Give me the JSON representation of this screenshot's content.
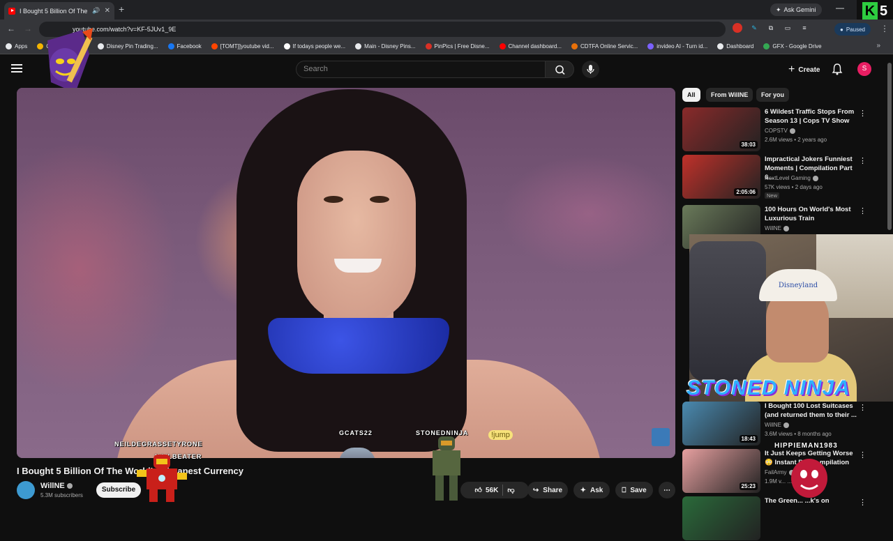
{
  "browser": {
    "tab_title": "I Bought 5 Billion Of The W",
    "new_tab": "+",
    "ask_gemini": "Ask Gemini",
    "url": "youtube.com/watch?v=KF-5JUv1_9E",
    "paused": "Paused",
    "bookmarks": [
      {
        "label": "Apps",
        "color": "#e8eaed"
      },
      {
        "label": "Comp...ive Gol...",
        "color": "#f4b400"
      },
      {
        "label": "Disney Pin Trading...",
        "color": "#e8eaed"
      },
      {
        "label": "Facebook",
        "color": "#1877f2"
      },
      {
        "label": "[TOMT]]youtube vid...",
        "color": "#ff4500"
      },
      {
        "label": "If todays people we...",
        "color": "#ffffff"
      },
      {
        "label": "Main - Disney Pins...",
        "color": "#e8eaed"
      },
      {
        "label": "PinPics | Free Disne...",
        "color": "#d93025"
      },
      {
        "label": "Channel dashboard...",
        "color": "#ff0000"
      },
      {
        "label": "CDTFA Online Servic...",
        "color": "#e8710a"
      },
      {
        "label": "invideo AI - Turn id...",
        "color": "#7b61ff"
      },
      {
        "label": "Dashboard",
        "color": "#e8eaed"
      },
      {
        "label": "GFX - Google Drive",
        "color": "#34a853"
      }
    ]
  },
  "youtube": {
    "search_placeholder": "Search",
    "create": "Create",
    "avatar_letter": "S"
  },
  "video": {
    "title": "I Bought 5 Billion Of The World's Cheapest Currency",
    "channel": "WillNE",
    "subscribers": "5.3M subscribers",
    "subscribe": "Subscribe",
    "likes": "56K",
    "share": "Share",
    "ask": "Ask",
    "save": "Save"
  },
  "stickers": {
    "gcats": "GCATS22",
    "stonedninja": "STONEDNINJA",
    "jump": "!jump",
    "neil": "NEILDEGRASSETYRONE",
    "nail": "NAILBEATER",
    "hippie": "HIPPIEMAN1983",
    "stoned_title": "STONED NINJA"
  },
  "chips": [
    "All",
    "From WillNE",
    "For you"
  ],
  "recommendations": [
    {
      "title": "6 Wildest Traffic Stops From Season 13 | Cops TV Show",
      "channel": "COPSTV",
      "meta": "2.6M views • 2 years ago",
      "duration": "38:03",
      "thumb_color": "#8a2a2a",
      "badge": ""
    },
    {
      "title": "Impractical Jokers Funniest Moments | Compilation Part 6...",
      "channel": "NextLevel Gaming",
      "meta": "57K views • 2 days ago",
      "duration": "2:05:06",
      "thumb_color": "#c0312a",
      "badge": "New"
    },
    {
      "title": "100 Hours On World's Most Luxurious Train",
      "channel": "WillNE",
      "meta": "",
      "duration": "",
      "thumb_color": "#6a7a5a",
      "badge": ""
    },
    {
      "title": "I Bought 100 Lost Suitcases (and returned them to their ...",
      "channel": "WillNE",
      "meta": "3.6M views • 8 months ago",
      "duration": "18:43",
      "thumb_color": "#4a8ab0",
      "badge": ""
    },
    {
      "title": "It Just Keeps Getting Worse 😳 Instant Re... ...mpilation",
      "channel": "FailArmy",
      "meta": "1.9M v... ...my 2.0",
      "duration": "25:23",
      "thumb_color": "#e7a0a0",
      "badge": ""
    },
    {
      "title": "The Green... ...k's on",
      "channel": "",
      "meta": "",
      "duration": "",
      "thumb_color": "#2a6a3a",
      "badge": ""
    }
  ],
  "cam": {
    "hat_text": "Disneyland"
  },
  "k5": {
    "k": "K",
    "five": "5"
  }
}
